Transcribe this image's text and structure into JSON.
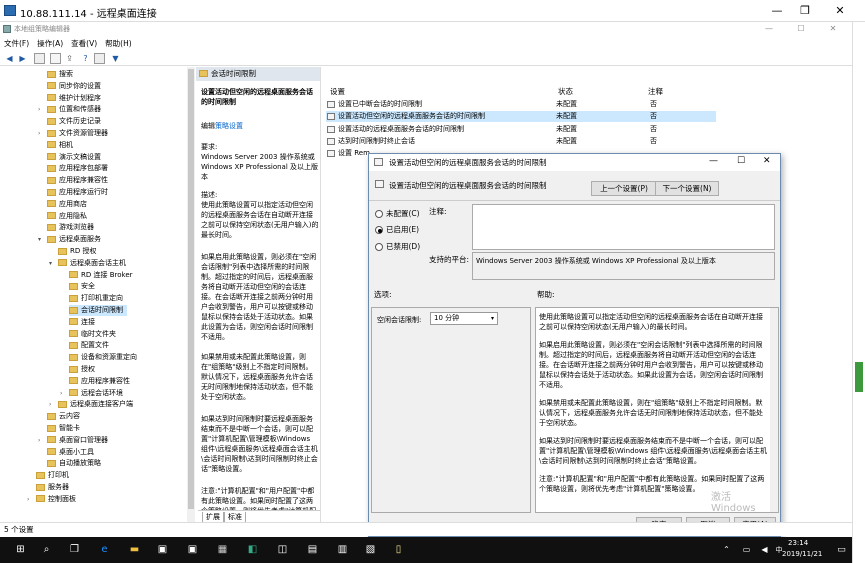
{
  "rdp": {
    "title": "10.88.111.14 - 远程桌面连接",
    "btn_min": "—",
    "btn_max": "❐",
    "btn_close": "✕"
  },
  "gpe": {
    "title": "本地组策略编辑器",
    "btn_min": "—",
    "btn_max": "☐",
    "btn_close": "✕"
  },
  "menu": [
    "文件(F)",
    "操作(A)",
    "查看(V)",
    "帮助(H)"
  ],
  "tree": [
    {
      "label": "搜索",
      "indent": 1
    },
    {
      "label": "同步你的设置",
      "indent": 1
    },
    {
      "label": "维护计划程序",
      "indent": 1
    },
    {
      "label": "位置和传感器",
      "indent": 1,
      "expand": ">"
    },
    {
      "label": "文件历史记录",
      "indent": 1
    },
    {
      "label": "文件资源管理器",
      "indent": 1,
      "expand": ">"
    },
    {
      "label": "相机",
      "indent": 1
    },
    {
      "label": "演示文稿设置",
      "indent": 1
    },
    {
      "label": "应用程序包部署",
      "indent": 1
    },
    {
      "label": "应用程序兼容性",
      "indent": 1
    },
    {
      "label": "应用程序运行时",
      "indent": 1
    },
    {
      "label": "应用商店",
      "indent": 1
    },
    {
      "label": "应用隐私",
      "indent": 1
    },
    {
      "label": "游戏浏览器",
      "indent": 1
    },
    {
      "label": "远程桌面服务",
      "indent": 1,
      "expand": "v"
    },
    {
      "label": "RD 授权",
      "indent": 2
    },
    {
      "label": "远程桌面会话主机",
      "indent": 2,
      "expand": "v"
    },
    {
      "label": "RD 连接 Broker",
      "indent": 3
    },
    {
      "label": "安全",
      "indent": 3
    },
    {
      "label": "打印机重定向",
      "indent": 3
    },
    {
      "label": "会话时间限制",
      "indent": 3,
      "selected": true
    },
    {
      "label": "连接",
      "indent": 3
    },
    {
      "label": "临时文件夹",
      "indent": 3
    },
    {
      "label": "配置文件",
      "indent": 3
    },
    {
      "label": "设备和资源重定向",
      "indent": 3
    },
    {
      "label": "授权",
      "indent": 3
    },
    {
      "label": "应用程序兼容性",
      "indent": 3
    },
    {
      "label": "远程会话环境",
      "indent": 3,
      "expand": ">"
    },
    {
      "label": "远程桌面连接客户端",
      "indent": 2,
      "expand": ">"
    },
    {
      "label": "云内容",
      "indent": 1
    },
    {
      "label": "智能卡",
      "indent": 1
    },
    {
      "label": "桌面窗口管理器",
      "indent": 1,
      "expand": ">"
    },
    {
      "label": "桌面小工具",
      "indent": 1
    },
    {
      "label": "自动播放策略",
      "indent": 1
    },
    {
      "label": "打印机",
      "indent": 0
    },
    {
      "label": "服务器",
      "indent": 0
    },
    {
      "label": "控制面板",
      "indent": 0,
      "expand": ">"
    }
  ],
  "mid": {
    "header": "会话时间限制",
    "policy_title": "设置活动但空闲的远程桌面服务会话的时间限制",
    "edit_prefix": "编辑",
    "edit_link": "策略设置",
    "requirements_label": "要求:",
    "requirements": "Windows Server 2003 操作系统或 Windows XP Professional 及以上版本",
    "desc_label": "描述:",
    "desc1": "使用此策略设置可以指定活动但空闲的远程桌面服务会话在自动断开连接之前可以保持空闲状态(无用户输入)的最长时间。",
    "desc2": "如果启用此策略设置，则必须在\"空闲会话限制\"列表中选择所需的时间限制。超过指定的时间后，远程桌面服务将自动断开活动但空闲的会话连接。在会话断开连接之前两分钟时用户会收到警告，用户可以按键或移动鼠标以保持会话处于活动状态。如果此设置为会话，则空闲会话时间限制不适用。",
    "desc3": "如果禁用或未配置此策略设置，则在\"组策略\"级别上不指定时间限制。默认情况下，远程桌面服务允许会话无时间限制地保持活动状态，但不能处于空闲状态。",
    "desc4": "如果达到时间限制时要远程桌面服务结束而不是中断一个会话，则可以配置\"计算机配置\\管理模板\\Windows 组件\\远程桌面服务\\远程桌面会话主机\\会话时间限制\\达到时间限制时终止会话\"策略设置。",
    "desc5": "注意:\"计算机配置\"和\"用户配置\"中都有此策略设置。如果同时配置了这两个策略设置，则将优先考虑\"计算机配置\"中的策略设置。",
    "tab_extended": "扩展",
    "tab_standard": "标准"
  },
  "list": {
    "col_setting": "设置",
    "col_state": "状态",
    "col_comment": "注释",
    "rows": [
      {
        "name": "设置已中断会话的时间限制",
        "state": "未配置",
        "comment": "否"
      },
      {
        "name": "设置活动但空闲的远程桌面服务会话的时间限制",
        "state": "未配置",
        "comment": "否",
        "selected": true
      },
      {
        "name": "设置活动的远程桌面服务会话的时间限制",
        "state": "未配置",
        "comment": "否"
      },
      {
        "name": "达到时间限制时终止会话",
        "state": "未配置",
        "comment": "否"
      },
      {
        "name": "设置 Rem",
        "state": "",
        "comment": ""
      }
    ]
  },
  "dialog": {
    "title": "设置活动但空闲的远程桌面服务会话的时间限制",
    "heading": "设置活动但空闲的远程桌面服务会话的时间限制",
    "prev": "上一个设置(P)",
    "next": "下一个设置(N)",
    "opt_not_configured": "未配置(C)",
    "opt_enabled": "已启用(E)",
    "opt_disabled": "已禁用(D)",
    "comment_label": "注释:",
    "supported_label": "支持的平台:",
    "supported_text": "Windows Server 2003 操作系统或 Windows XP Professional 及以上版本",
    "options_label": "选项:",
    "help_label": "帮助:",
    "idle_label": "空闲会话限制:",
    "idle_value": "10 分钟",
    "help1": "使用此策略设置可以指定活动但空闲的远程桌面服务会话在自动断开连接之前可以保持空闲状态(无用户输入)的最长时间。",
    "help2": "如果启用此策略设置，则必须在\"空闲会话限制\"列表中选择所需的时间限制。超过指定的时间后，远程桌面服务将自动断开活动但空闲的会话连接。在会话断开连接之前两分钟时用户会收到警告，用户可以按键或移动鼠标以保持会话处于活动状态。如果此设置为会话，则空闲会话时间限制不适用。",
    "help3": "如果禁用或未配置此策略设置，则在\"组策略\"级别上不指定时间限制。默认情况下，远程桌面服务允许会话无时间限制地保持活动状态，但不能处于空闲状态。",
    "help4": "如果达到时间限制时要远程桌面服务结束而不是中断一个会话，则可以配置\"计算机配置\\管理模板\\Windows 组件\\远程桌面服务\\远程桌面会话主机\\会话时间限制\\达到时间限制时终止会话\"策略设置。",
    "help5": "注意:\"计算机配置\"和\"用户配置\"中都有此策略设置。如果同时配置了这两个策略设置，则将优先考虑\"计算机配置\"策略设置。",
    "ok": "确定",
    "cancel": "取消",
    "apply": "应用(A)",
    "watermark": "激活 Windows"
  },
  "status": "5 个设置",
  "clock": {
    "time": "23:14",
    "date": "2019/11/21"
  },
  "colors": {
    "selected": "#cce8ff",
    "taskbar": "#101010",
    "accent": "#0078d7"
  }
}
